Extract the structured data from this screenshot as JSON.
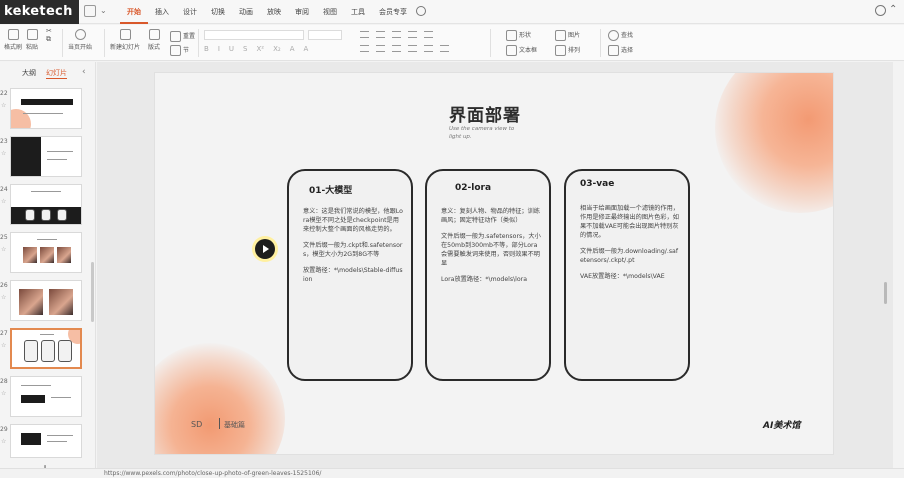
{
  "app": {
    "logo_text": "keketech"
  },
  "menu": {
    "tabs": [
      {
        "label": "开始"
      },
      {
        "label": "插入"
      },
      {
        "label": "设计"
      },
      {
        "label": "切换"
      },
      {
        "label": "动画"
      },
      {
        "label": "放映"
      },
      {
        "label": "审阅"
      },
      {
        "label": "视图"
      },
      {
        "label": "工具"
      },
      {
        "label": "会员专享"
      }
    ],
    "active_tab": "开始"
  },
  "ribbon": {
    "format_painter": "格式刷",
    "paste": "粘贴",
    "start_from_current": "当页开始",
    "new_slide": "新建幻灯片",
    "layout": "版式",
    "reset": "重置",
    "section": "节",
    "shape": "形状",
    "image": "图片",
    "textbox": "文本框",
    "arrange": "排列",
    "find": "查找",
    "select": "选择"
  },
  "sidebar": {
    "tabs": [
      "大纲",
      "幻灯片"
    ],
    "active_tab": "幻灯片",
    "slide_numbers": [
      "22",
      "23",
      "24",
      "25",
      "26",
      "27",
      "28",
      "29"
    ],
    "active_slide": "27"
  },
  "slide": {
    "title": "界面部署",
    "subtitle": "Use the camera view to light up.",
    "cards": [
      {
        "heading": "01-大模型",
        "paragraphs": [
          "意义：这是我们常说的模型，他跟Lora模型不同之处是checkpoint是用来控制大整个画面的风格走势的。",
          "文件后缀一般为.ckpt和.safetensors，模型大小为2G到8G不等",
          "放置路径：*\\models\\Stable-diffusion"
        ]
      },
      {
        "heading": "02-lora",
        "paragraphs": [
          "意义：复刻人物、物品的特征；训练画风；固定特征动作（类似）",
          "文件后缀一般为.safetensors，大小在50mb到300mb不等，部分Lora会需要触发词来使用，否则效果不明显",
          "Lora放置路径：*\\models\\lora"
        ]
      },
      {
        "heading": "03-vae",
        "paragraphs": [
          "相当于给画面加载一个滤镜的作用，作用是修正最终输出的图片色彩，如果不加载VAE可能会出现图片特别灰的情况。",
          "文件后缀一般为.downloading/.safetensors/.ckpt/.pt",
          "VAE放置路径：*\\models\\VAE"
        ]
      }
    ],
    "footer_left": "SD",
    "footer_text": "基础篇",
    "logo": "AI美术馆"
  },
  "status": {
    "url": "https://www.pexels.com/photo/close-up-photo-of-green-leaves-1525106/"
  }
}
